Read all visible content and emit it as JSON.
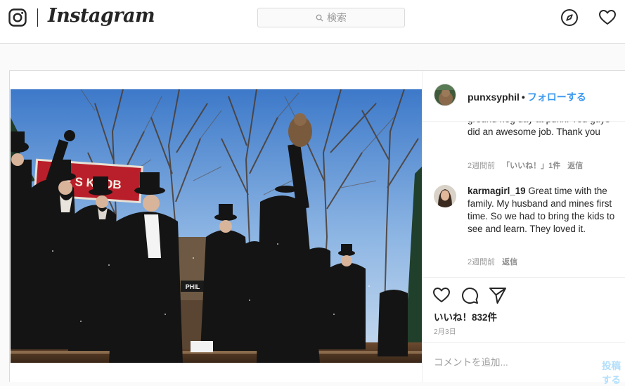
{
  "nav": {
    "wordmark": "Instagram",
    "search_placeholder": "検索"
  },
  "post": {
    "username": "punxsyphil",
    "separator": "•",
    "follow_label": "フォローする",
    "photo_sign_text": "BE  S KNOB",
    "photo_podium_text": "PHIL",
    "comments": [
      {
        "text_partial": "ground hog day at punx. You guys did an awesome job. Thank you",
        "age": "2週間前",
        "likes": "「いいね！」1件",
        "reply": "返信"
      },
      {
        "username": "karmagirl_19",
        "text": "Great time with the family. My husband and mines first time. So we had to bring the kids to see and learn. They loved it.",
        "age": "2週間前",
        "reply": "返信"
      }
    ],
    "likes_label": "いいね！832件",
    "date": "2月3日",
    "add_comment_placeholder": "コメントを追加...",
    "post_label": "投稿する"
  },
  "colors": {
    "link_blue": "#3897f0",
    "post_disabled": "#b2dffc",
    "border": "#dbdbdb"
  }
}
